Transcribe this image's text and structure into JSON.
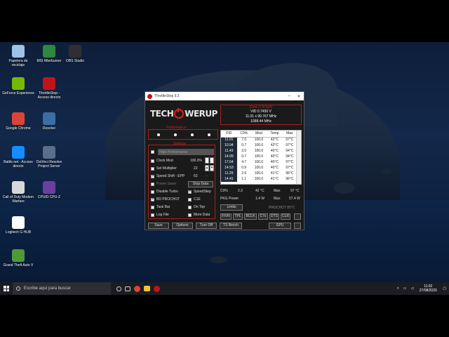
{
  "desktop": {
    "icons": [
      {
        "label": "Papelera de reciclaje",
        "icon": "recycle-bin-icon",
        "color": "#9ec3e6"
      },
      {
        "label": "MSI Afterburner",
        "icon": "afterburner-icon",
        "color": "#2b8a3e"
      },
      {
        "label": "OBS Studio",
        "icon": "obs-icon",
        "color": "#302e31"
      },
      {
        "label": "GeForce Experience",
        "icon": "geforce-icon",
        "color": "#76b900"
      },
      {
        "label": "ThrottleStop - Acceso directo",
        "icon": "throttlestop-icon",
        "color": "#c0141b"
      },
      {
        "label": "Google Chrome",
        "icon": "chrome-icon",
        "color": "#db4437"
      },
      {
        "label": "Resolve",
        "icon": "resolve-icon",
        "color": "#3a6ea5"
      },
      {
        "label": "Battle.net - Acceso directo",
        "icon": "battlenet-icon",
        "color": "#148eff"
      },
      {
        "label": "DaVinci Resolve Project Server",
        "icon": "davinci-server-icon",
        "color": "#5a6f8a"
      },
      {
        "label": "Call of Duty Modern Warfare",
        "icon": "cod-icon",
        "color": "#d8d8d8"
      },
      {
        "label": "CPUID CPU-Z",
        "icon": "cpuz-icon",
        "color": "#6a3fa0"
      },
      {
        "label": "Logitech G HUB",
        "icon": "ghub-icon",
        "color": "#ffffff"
      },
      {
        "label": "Grand Theft Auto V",
        "icon": "gta-icon",
        "color": "#4c9a3a"
      }
    ]
  },
  "taskbar": {
    "search_placeholder": "Escribe aquí para buscar",
    "time": "11:02",
    "date": "27/08/2020"
  },
  "window": {
    "title": "ThrottleStop 9.2",
    "logo": {
      "pre": "TECH",
      "post": "WERUP"
    },
    "performance_label": "Performance",
    "settings_label": "Settings",
    "profile_field": "High Performance",
    "settings": [
      {
        "label": "Clock Mod",
        "checked": false,
        "value": "100.0%"
      },
      {
        "label": "Set Multiplier",
        "checked": false,
        "value": "22"
      },
      {
        "label": "Speed Shift - EPP",
        "checked": true,
        "value": "63"
      },
      {
        "label": "Power Saver",
        "checked": false
      }
    ],
    "stop_data_button": "Stop Data",
    "checks_left": [
      {
        "label": "Disable Turbo",
        "checked": false
      },
      {
        "label": "BD PROCHOT",
        "checked": true
      },
      {
        "label": "Task Bar",
        "checked": false
      },
      {
        "label": "Log File",
        "checked": false
      }
    ],
    "checks_right": [
      {
        "label": "SpeedStep",
        "checked": true
      },
      {
        "label": "C1E",
        "checked": false
      },
      {
        "label": "On Top",
        "checked": false
      },
      {
        "label": "More Data",
        "checked": false
      }
    ],
    "bottom_buttons": [
      "Save",
      "Options",
      "Turn Off",
      "TS Bench"
    ],
    "cpu_name": "Core i7-9750H",
    "vid": "VID  0.7450 V",
    "multiplier": "11.01 x 99.767 MHz",
    "freq": "1098.44 MHz",
    "grid_headers": [
      "FID",
      "C0%",
      "Mod",
      "Temp",
      "Max"
    ],
    "grid_rows": [
      [
        "11.01",
        "7.0",
        "100.0",
        "42°C",
        "97°C"
      ],
      [
        "10.94",
        "0.7",
        "100.0",
        "42°C",
        "97°C"
      ],
      [
        "11.43",
        "3.0",
        "100.0",
        "40°C",
        "94°C"
      ],
      [
        "14.09",
        "0.7",
        "100.0",
        "40°C",
        "94°C"
      ],
      [
        "17.64",
        "4.7",
        "100.0",
        "40°C",
        "97°C"
      ],
      [
        "14.53",
        "0.9",
        "100.0",
        "40°C",
        "97°C"
      ],
      [
        "11.29",
        "2.6",
        "100.0",
        "41°C",
        "96°C"
      ],
      [
        "14.41",
        "1.1",
        "100.0",
        "41°C",
        "96°C"
      ]
    ],
    "summary": {
      "c0_label": "C0%",
      "c0_val": "2.3",
      "temp": "42 °C",
      "max_label": "Max",
      "max_temp": "97 °C",
      "pkg_label": "PKG Power",
      "pkg_val": "1.4 W",
      "pkg_max": "57.4 W"
    },
    "limits_button": "Limits",
    "prochot_label": "PROCHOT 85°C",
    "tool_buttons": [
      "FIVR",
      "TPL",
      "BCLK",
      "C7s",
      "DTS",
      "CLR"
    ],
    "gpu_button": "GPU"
  }
}
